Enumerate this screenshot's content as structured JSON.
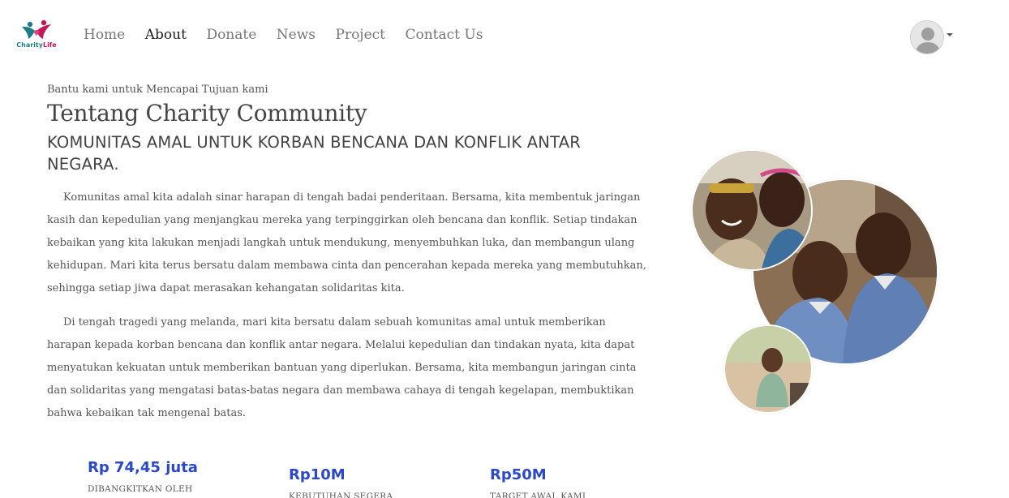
{
  "brand": {
    "logo_name_a": "Charity",
    "logo_name_b": "Life",
    "accent_teal": "#1f7d8a",
    "accent_pink": "#c2185b"
  },
  "nav": {
    "items": [
      {
        "label": "Home",
        "active": false
      },
      {
        "label": "About",
        "active": true
      },
      {
        "label": "Donate",
        "active": false
      },
      {
        "label": "News",
        "active": false
      },
      {
        "label": "Project",
        "active": false
      },
      {
        "label": "Contact Us",
        "active": false
      }
    ],
    "profile_icon": "user-avatar-icon"
  },
  "about": {
    "eyebrow": "Bantu kami untuk Mencapai Tujuan kami",
    "title": "Tentang Charity Community",
    "subtitle": "KOMUNITAS AMAL UNTUK KORBAN BENCANA DAN KONFLIK ANTAR NEGARA.",
    "paragraphs": [
      "Komunitas amal kita adalah sinar harapan di tengah badai penderitaan. Bersama, kita membentuk jaringan kasih dan kepedulian yang menjangkau mereka yang terpinggirkan oleh bencana dan konflik. Setiap tindakan kebaikan yang kita lakukan menjadi langkah untuk mendukung, menyembuhkan luka, dan membangun ulang kehidupan. Mari kita terus bersatu dalam membawa cinta dan pencerahan kepada mereka yang membutuhkan, sehingga setiap jiwa dapat merasakan kehangatan solidaritas kita.",
      "Di tengah tragedi yang melanda, mari kita bersatu dalam sebuah komunitas amal untuk memberikan harapan kepada korban bencana dan konflik antar negara. Melalui kepedulian dan tindakan nyata, kita dapat menyatukan kekuatan untuk memberikan bantuan yang diperlukan. Bersama, kita membangun jaringan cinta dan solidaritas yang mengatasi batas-batas negara dan membawa cahaya di tengah kegelapan, membuktikan bahwa kebaikan tak mengenal batas."
    ]
  },
  "stats": [
    {
      "value": "Rp 74,45 juta",
      "label": "DIBANGKITKAN OLEH"
    },
    {
      "value": "Rp10M",
      "label": "KEBUTUHAN SEGERA"
    },
    {
      "value": "Rp50M",
      "label": "TARGET AWAL KAMI"
    }
  ],
  "stat_color": "#2b48c8"
}
